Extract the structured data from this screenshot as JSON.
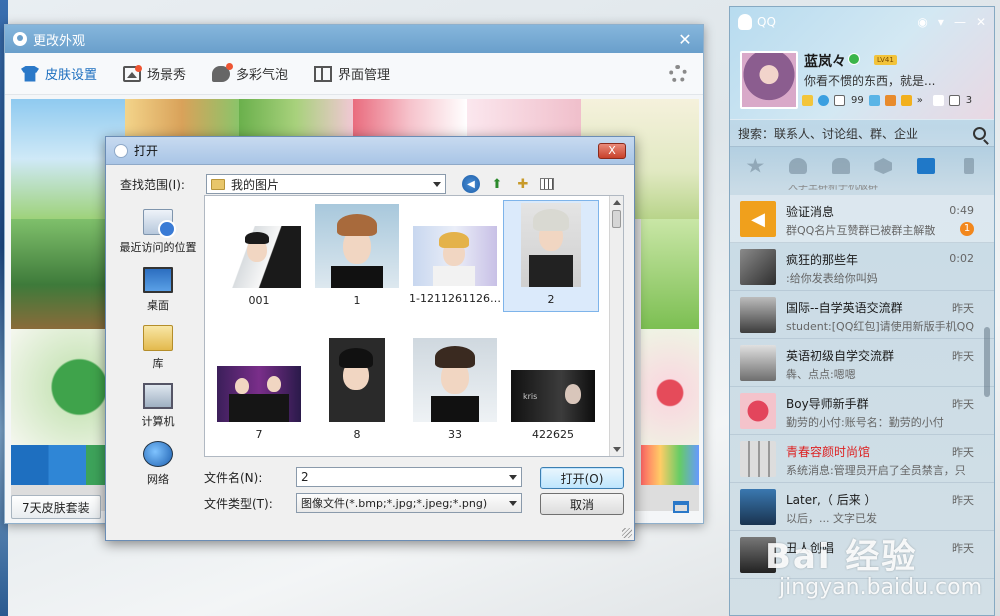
{
  "skin_window": {
    "title": "更改外观",
    "tabs": [
      {
        "label": "皮肤设置",
        "icon": "shirt-icon",
        "active": true
      },
      {
        "label": "场景秀",
        "icon": "picture-icon",
        "active": false
      },
      {
        "label": "多彩气泡",
        "icon": "bubble-icon",
        "active": false
      },
      {
        "label": "界面管理",
        "icon": "layout-icon",
        "active": false
      }
    ],
    "bottom_button": "7天皮肤套装",
    "bottom_button_2": ""
  },
  "open_dialog": {
    "title": "打开",
    "close_label": "X",
    "look_in_label": "查找范围(I):",
    "look_in_value": "我的图片",
    "places": [
      {
        "label": "最近访问的位置",
        "icon": "recent-places-icon"
      },
      {
        "label": "桌面",
        "icon": "desktop-icon"
      },
      {
        "label": "库",
        "icon": "library-icon"
      },
      {
        "label": "计算机",
        "icon": "computer-icon"
      },
      {
        "label": "网络",
        "icon": "network-icon"
      }
    ],
    "files": [
      {
        "name": "001",
        "selected": false
      },
      {
        "name": "1",
        "selected": false
      },
      {
        "name": "1-12112611262...",
        "selected": false
      },
      {
        "name": "2",
        "selected": true
      },
      {
        "name": "7",
        "selected": false
      },
      {
        "name": "8",
        "selected": false
      },
      {
        "name": "33",
        "selected": false
      },
      {
        "name": "422625",
        "selected": false
      }
    ],
    "thumb_caption": "kris",
    "filename_label": "文件名(N):",
    "filename_value": "2",
    "filetype_label": "文件类型(T):",
    "filetype_value": "图像文件(*.bmp;*.jpg;*.jpeg;*.png)",
    "open_button": "打开(O)",
    "cancel_button": "取消"
  },
  "qq_panel": {
    "title": "QQ",
    "nickname": "蓝岚々",
    "level_badge": "LV41",
    "signature": "你看不惯的东西，就是...",
    "mail_count": "99",
    "member_count": "3",
    "search_placeholder": "搜索：联系人、讨论组、群、企业",
    "cut_row": "大学生群新手机版群",
    "contacts": [
      {
        "name": "验证消息",
        "message": "群QQ名片互赞群已被群主解散",
        "time": "0:49",
        "badge": "1",
        "red_name": false,
        "highlight": true,
        "avatar_color": "#f0a01c"
      },
      {
        "name": "疯狂的那些年",
        "message": ":给你发表给你叫妈",
        "time": "0:02",
        "badge": "",
        "red_name": false,
        "highlight": false,
        "avatar_color": "#5a5a5a"
      },
      {
        "name": "国际--自学英语交流群",
        "message": "student:[QQ红包]请使用新版手机QQ",
        "time": "昨天",
        "badge": "",
        "red_name": false,
        "highlight": false,
        "avatar_color": "#3c3c3c"
      },
      {
        "name": "英语初级自学交流群",
        "message": "犇、点点:嗯嗯",
        "time": "昨天",
        "badge": "",
        "red_name": false,
        "highlight": false,
        "avatar_color": "#6e6e6e"
      },
      {
        "name": "Boy导师新手群",
        "message": "勤劳的小付:账号名：勤劳的小付",
        "time": "昨天",
        "badge": "",
        "red_name": false,
        "highlight": false,
        "avatar_color": "#d8566c"
      },
      {
        "name": "青春容颜时尚馆",
        "message": "系统消息:管理员开启了全员禁言，只",
        "time": "昨天",
        "badge": "",
        "red_name": true,
        "highlight": false,
        "avatar_color": "#b7b7b7"
      },
      {
        "name": "Later,（ 后来 ）",
        "message": "以后，... 文字已发",
        "time": "昨天",
        "badge": "",
        "red_name": false,
        "highlight": false,
        "avatar_color": "#2e5d86"
      },
      {
        "name": "丑人创唱",
        "message": "",
        "time": "昨天",
        "badge": "",
        "red_name": false,
        "highlight": false,
        "avatar_color": "#333333"
      }
    ]
  },
  "watermark": {
    "logo": "Bai 经验",
    "url": "jingyan.baidu.com"
  }
}
